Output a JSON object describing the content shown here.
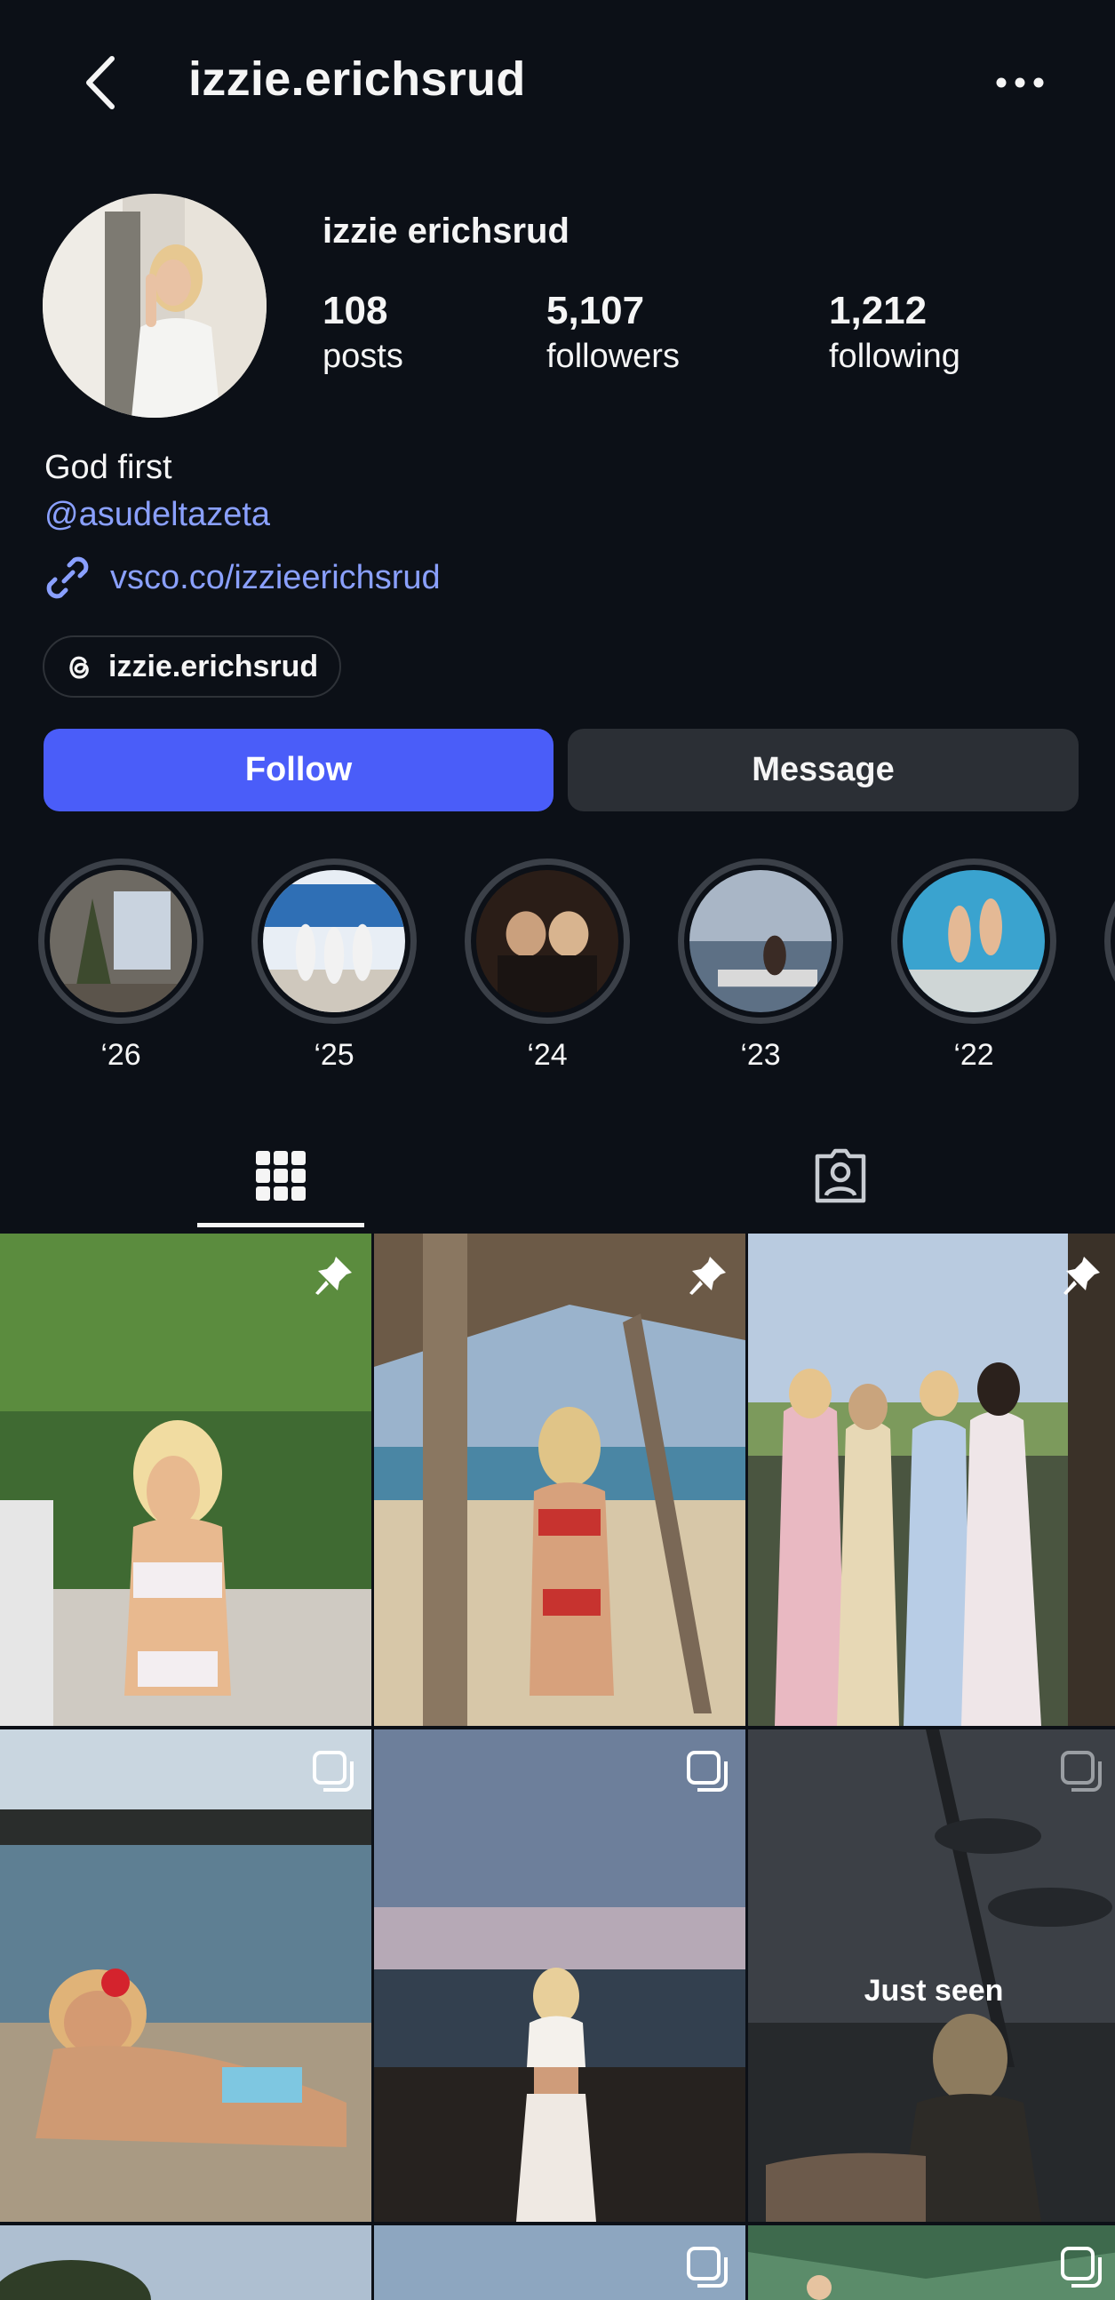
{
  "header": {
    "username": "izzie.erichsrud"
  },
  "profile": {
    "display_name": "izzie erichsrud",
    "stats": [
      {
        "value": "108",
        "label": "posts"
      },
      {
        "value": "5,107",
        "label": "followers"
      },
      {
        "value": "1,212",
        "label": "following"
      }
    ],
    "bio": "God first",
    "mention": "@asudeltazeta",
    "link": "vsco.co/izzieerichsrud",
    "threads_handle": "izzie.erichsrud"
  },
  "actions": {
    "follow_label": "Follow",
    "message_label": "Message"
  },
  "highlights": [
    {
      "label": "‘26"
    },
    {
      "label": "‘25"
    },
    {
      "label": "‘24"
    },
    {
      "label": "‘23"
    },
    {
      "label": "‘22"
    }
  ],
  "tabs": [
    {
      "icon": "grid-icon",
      "active": true
    },
    {
      "icon": "tagged-icon",
      "active": false
    }
  ],
  "grid": [
    {
      "badge": "pin-icon"
    },
    {
      "badge": "pin-icon"
    },
    {
      "badge": "pin-icon"
    },
    {
      "badge": "carousel-icon"
    },
    {
      "badge": "carousel-icon"
    },
    {
      "badge": "carousel-icon",
      "overlay_text": "Just seen"
    },
    {
      "badge": "none"
    },
    {
      "badge": "carousel-icon"
    },
    {
      "badge": "carousel-icon"
    }
  ],
  "colors": {
    "background": "#0c1017",
    "accent": "#4a5df9",
    "link": "#8aa0ff",
    "secondary_button": "#2b2f35"
  }
}
